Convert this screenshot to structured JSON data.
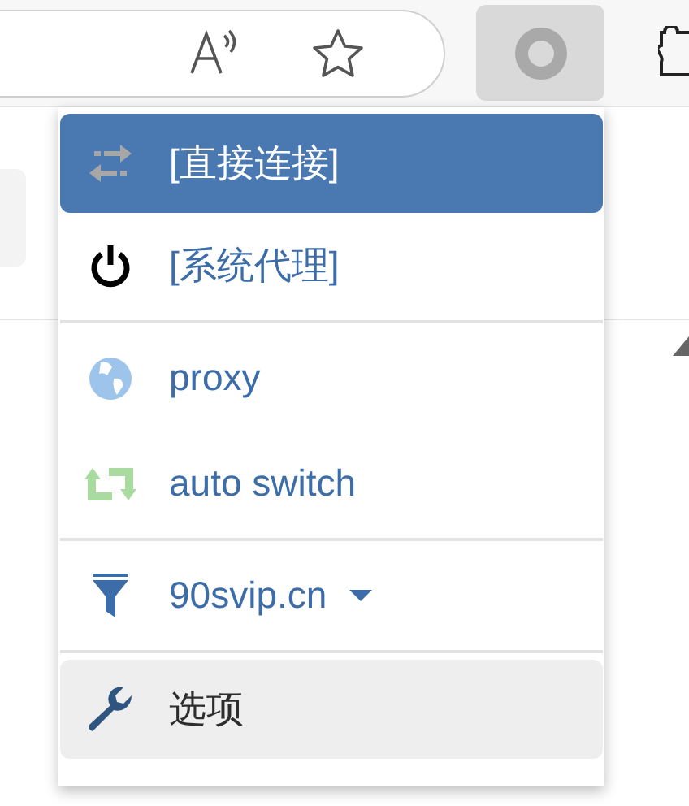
{
  "menu": {
    "groups": [
      {
        "items": [
          {
            "label": "[直接连接]",
            "kind": "direct",
            "selected": true,
            "hovered": false,
            "dropdown": false
          },
          {
            "label": "[系统代理]",
            "kind": "system",
            "selected": false,
            "hovered": false,
            "dropdown": false
          }
        ]
      },
      {
        "items": [
          {
            "label": "proxy",
            "kind": "server",
            "selected": false,
            "hovered": false,
            "dropdown": false
          },
          {
            "label": "auto switch",
            "kind": "switch",
            "selected": false,
            "hovered": false,
            "dropdown": false
          }
        ]
      },
      {
        "items": [
          {
            "label": "90svip.cn",
            "kind": "rule",
            "selected": false,
            "hovered": false,
            "dropdown": true
          }
        ]
      },
      {
        "items": [
          {
            "label": "选项",
            "kind": "options",
            "selected": false,
            "hovered": true,
            "dropdown": false
          }
        ]
      }
    ]
  }
}
